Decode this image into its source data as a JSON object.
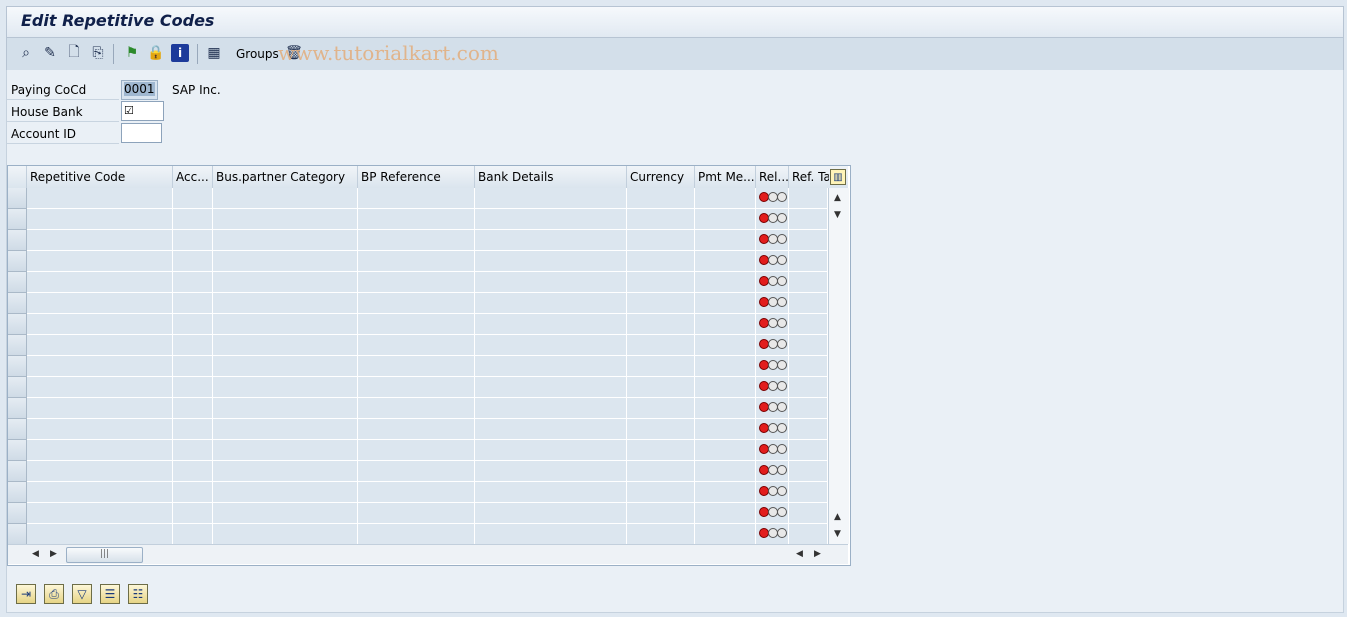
{
  "window": {
    "title": "Edit Repetitive Codes"
  },
  "toolbar": {
    "groups_label": "Groups",
    "watermark": "www.tutorialkart.com",
    "icons": [
      "display-change-icon",
      "pencil-icon",
      "new-document-icon",
      "copy-icon",
      "flag-icon",
      "lock-icon",
      "info-icon",
      "table-settings-icon",
      "trash-icon"
    ]
  },
  "form": {
    "paying_cocd": {
      "label": "Paying CoCd",
      "value": "0001",
      "description": "SAP Inc."
    },
    "house_bank": {
      "label": "House Bank",
      "value": "☑"
    },
    "account_id": {
      "label": "Account ID",
      "value": ""
    }
  },
  "table": {
    "columns": [
      "Repetitive Code",
      "Acc...",
      "Bus.partner Category",
      "BP Reference",
      "Bank Details",
      "Currency",
      "Pmt Me...",
      "Rel...",
      "Ref. Ta"
    ],
    "row_count": 17,
    "release_status": "red"
  },
  "bottom_buttons": [
    "export-icon",
    "print-icon",
    "filter-icon",
    "select-all-icon",
    "deselect-all-icon"
  ]
}
